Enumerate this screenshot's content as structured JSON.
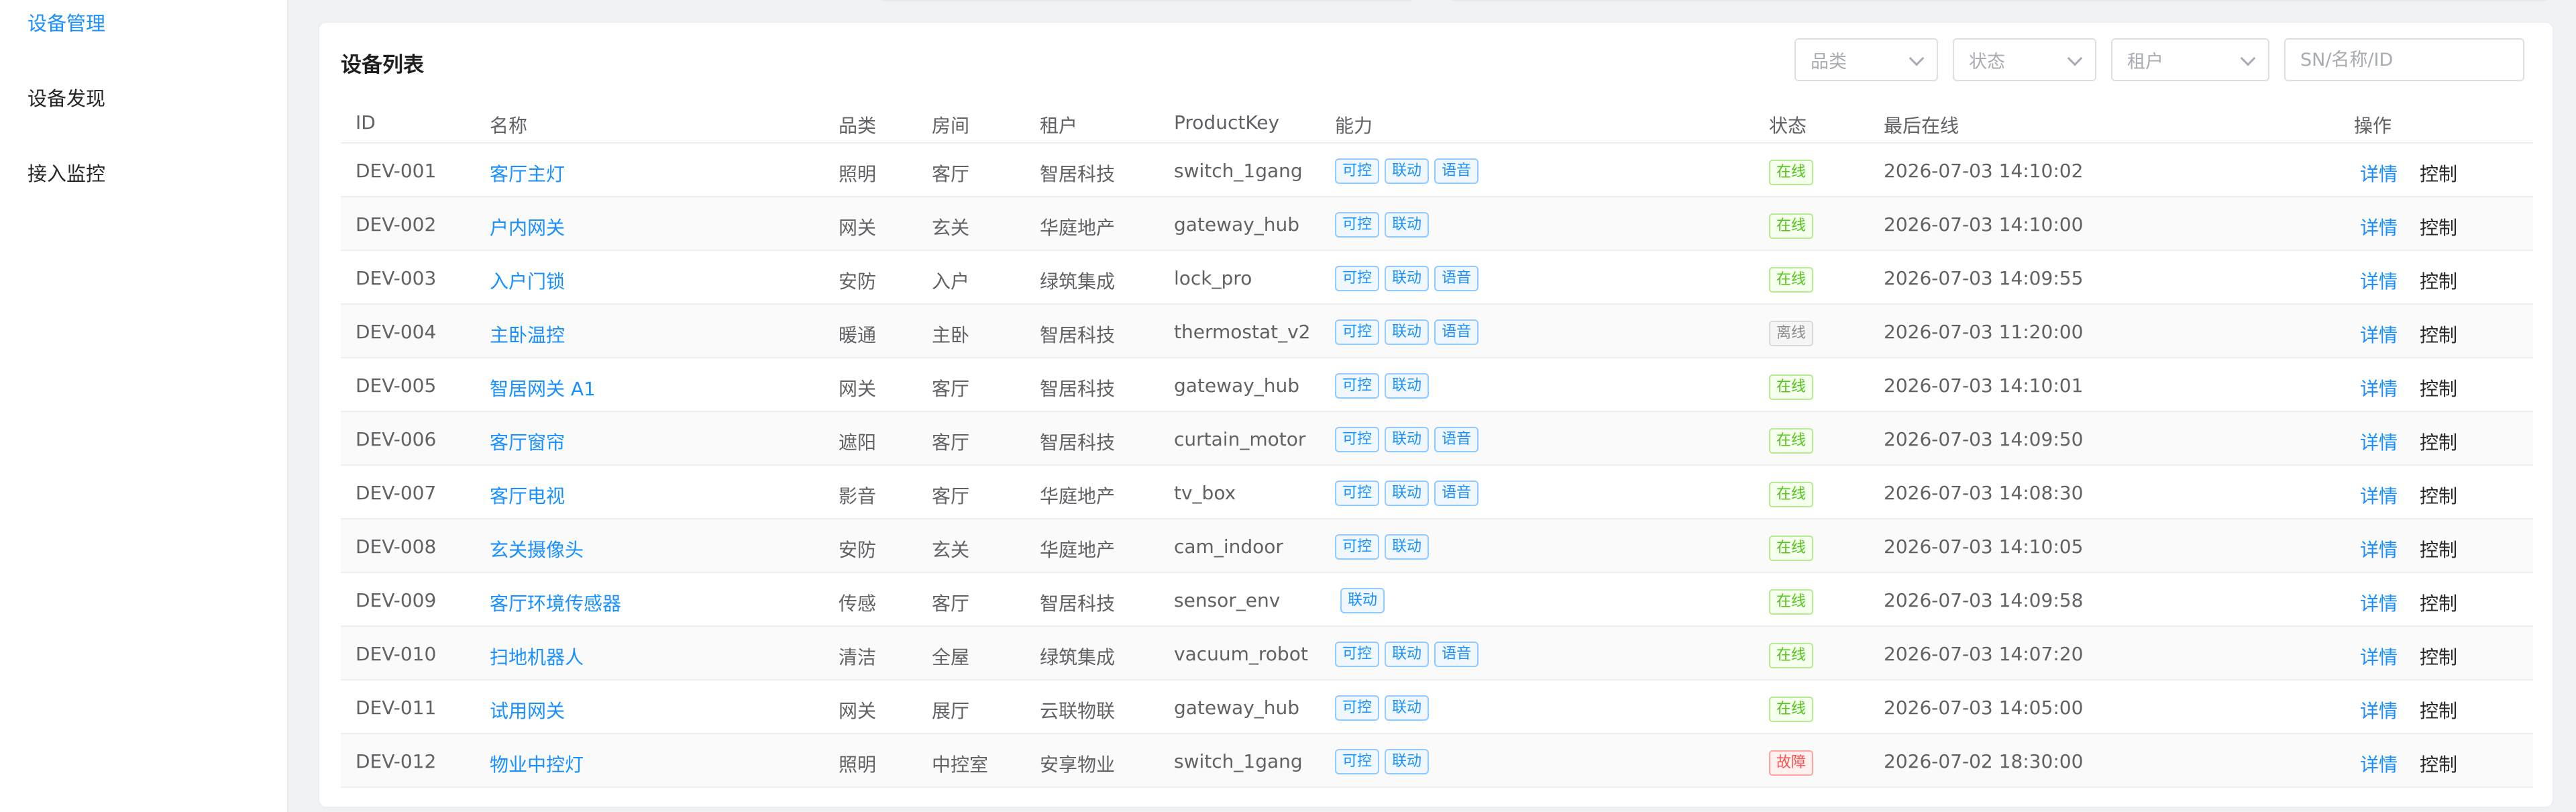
{
  "sidebar": {
    "items": [
      {
        "label": "设备管理",
        "active": true
      },
      {
        "label": "设备发现",
        "active": false
      },
      {
        "label": "接入监控",
        "active": false
      }
    ]
  },
  "card": {
    "title": "设备列表",
    "filters": {
      "category_placeholder": "品类",
      "status_placeholder": "状态",
      "tenant_placeholder": "租户",
      "search_placeholder": "SN/名称/ID"
    }
  },
  "table": {
    "headers": {
      "id": "ID",
      "name": "名称",
      "category": "品类",
      "room": "房间",
      "tenant": "租户",
      "product_key": "ProductKey",
      "capability": "能力",
      "status": "状态",
      "last_online": "最后在线",
      "actions": "操作"
    },
    "action_labels": {
      "detail": "详情",
      "control": "控制"
    },
    "rows": [
      {
        "id": "DEV-001",
        "name": "客厅主灯",
        "category": "照明",
        "room": "客厅",
        "tenant": "智居科技",
        "product_key": "switch_1gang",
        "caps": [
          "可控",
          "联动",
          "语音"
        ],
        "status": "在线",
        "status_type": "ok",
        "last_online": "2026-07-03 14:10:02"
      },
      {
        "id": "DEV-002",
        "name": "户内网关",
        "category": "网关",
        "room": "玄关",
        "tenant": "华庭地产",
        "product_key": "gateway_hub",
        "caps": [
          "可控",
          "联动"
        ],
        "status": "在线",
        "status_type": "ok",
        "last_online": "2026-07-03 14:10:00"
      },
      {
        "id": "DEV-003",
        "name": "入户门锁",
        "category": "安防",
        "room": "入户",
        "tenant": "绿筑集成",
        "product_key": "lock_pro",
        "caps": [
          "可控",
          "联动",
          "语音"
        ],
        "status": "在线",
        "status_type": "ok",
        "last_online": "2026-07-03 14:09:55"
      },
      {
        "id": "DEV-004",
        "name": "主卧温控",
        "category": "暖通",
        "room": "主卧",
        "tenant": "智居科技",
        "product_key": "thermostat_v2",
        "caps": [
          "可控",
          "联动",
          "语音"
        ],
        "status": "离线",
        "status_type": "off",
        "last_online": "2026-07-03 11:20:00"
      },
      {
        "id": "DEV-005",
        "name": "智居网关 A1",
        "category": "网关",
        "room": "客厅",
        "tenant": "智居科技",
        "product_key": "gateway_hub",
        "caps": [
          "可控",
          "联动"
        ],
        "status": "在线",
        "status_type": "ok",
        "last_online": "2026-07-03 14:10:01"
      },
      {
        "id": "DEV-006",
        "name": "客厅窗帘",
        "category": "遮阳",
        "room": "客厅",
        "tenant": "智居科技",
        "product_key": "curtain_motor",
        "caps": [
          "可控",
          "联动",
          "语音"
        ],
        "status": "在线",
        "status_type": "ok",
        "last_online": "2026-07-03 14:09:50"
      },
      {
        "id": "DEV-007",
        "name": "客厅电视",
        "category": "影音",
        "room": "客厅",
        "tenant": "华庭地产",
        "product_key": "tv_box",
        "caps": [
          "可控",
          "联动",
          "语音"
        ],
        "status": "在线",
        "status_type": "ok",
        "last_online": "2026-07-03 14:08:30"
      },
      {
        "id": "DEV-008",
        "name": "玄关摄像头",
        "category": "安防",
        "room": "玄关",
        "tenant": "华庭地产",
        "product_key": "cam_indoor",
        "caps": [
          "可控",
          "联动"
        ],
        "status": "在线",
        "status_type": "ok",
        "last_online": "2026-07-03 14:10:05"
      },
      {
        "id": "DEV-009",
        "name": "客厅环境传感器",
        "category": "传感",
        "room": "客厅",
        "tenant": "智居科技",
        "product_key": "sensor_env",
        "caps": [
          "联动"
        ],
        "status": "在线",
        "status_type": "ok",
        "last_online": "2026-07-03 14:09:58"
      },
      {
        "id": "DEV-010",
        "name": "扫地机器人",
        "category": "清洁",
        "room": "全屋",
        "tenant": "绿筑集成",
        "product_key": "vacuum_robot",
        "caps": [
          "可控",
          "联动",
          "语音"
        ],
        "status": "在线",
        "status_type": "ok",
        "last_online": "2026-07-03 14:07:20"
      },
      {
        "id": "DEV-011",
        "name": "试用网关",
        "category": "网关",
        "room": "展厅",
        "tenant": "云联物联",
        "product_key": "gateway_hub",
        "caps": [
          "可控",
          "联动"
        ],
        "status": "在线",
        "status_type": "ok",
        "last_online": "2026-07-03 14:05:00"
      },
      {
        "id": "DEV-012",
        "name": "物业中控灯",
        "category": "照明",
        "room": "中控室",
        "tenant": "安享物业",
        "product_key": "switch_1gang",
        "caps": [
          "可控",
          "联动"
        ],
        "status": "故障",
        "status_type": "err",
        "last_online": "2026-07-02 18:30:00"
      }
    ]
  },
  "colors": {
    "accent": "#1890ff",
    "online": "#52c41a",
    "offline": "#8c8c8c",
    "fault": "#ff4d4f"
  }
}
